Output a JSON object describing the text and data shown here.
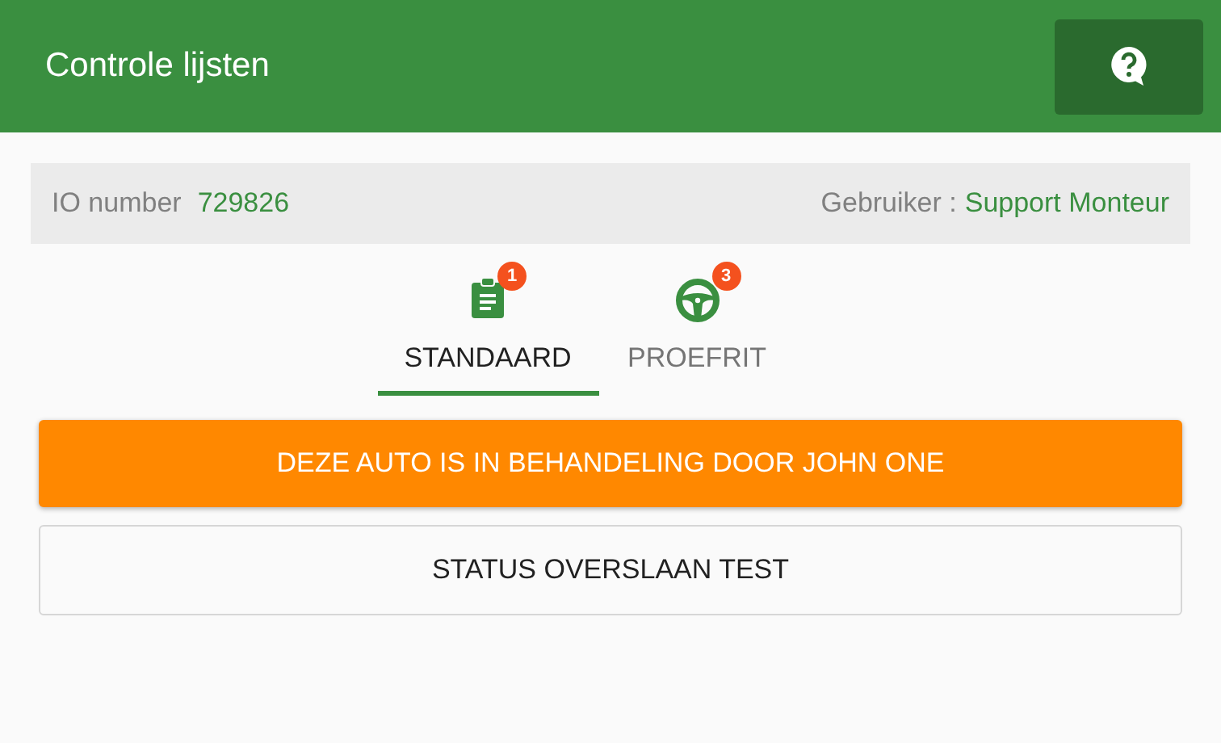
{
  "app_bar": {
    "title": "Controle lijsten"
  },
  "info_bar": {
    "io_label": "IO number",
    "io_value": "729826",
    "user_label": "Gebruiker :",
    "user_value": "Support Monteur"
  },
  "tabs": [
    {
      "label": "STANDAARD",
      "badge": "1",
      "kind": "checklist",
      "selected": true
    },
    {
      "label": "PROEFRIT",
      "badge": "3",
      "kind": "steering",
      "selected": false
    }
  ],
  "buttons": [
    {
      "label": "DEZE AUTO IS IN BEHANDELING DOOR JOHN ONE",
      "kind": "primary"
    },
    {
      "label": "STATUS OVERSLAAN TEST",
      "kind": "outline"
    }
  ]
}
